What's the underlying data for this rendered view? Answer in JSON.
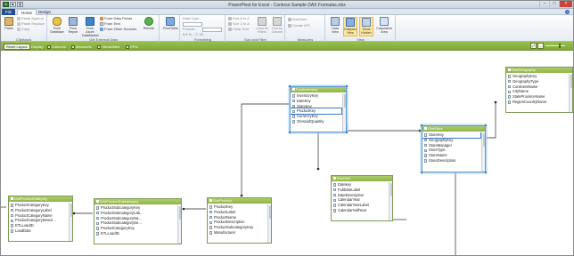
{
  "window": {
    "title": "PowerPivot for Excel - Contoso Sample DAX Formulas.xlsx"
  },
  "tabs": {
    "file": "File",
    "home": "Home",
    "design": "Design"
  },
  "ribbon": {
    "clipboard": {
      "label": "Clipboard",
      "paste": "Paste",
      "paste_append": "Paste Append",
      "paste_replace": "Paste Replace",
      "copy": "Copy"
    },
    "external": {
      "label": "Get External Data",
      "from_database": "From Database",
      "from_report": "From Report",
      "from_azure": "From Azure DataMarket",
      "from_data_feeds": "From Data Feeds",
      "from_text": "From Text",
      "from_other": "From Other Sources",
      "refresh": "Refresh"
    },
    "pivot": {
      "pivottable": "PivotTable"
    },
    "formatting": {
      "label": "Formatting",
      "data_type": "Data Type :",
      "format": "Format :"
    },
    "sort": {
      "label": "Sort and Filter",
      "asc": "Sort A to Z",
      "desc": "Sort Z to A",
      "clear_sort": "Clear Sort",
      "clear_filters": "Clear All Filters",
      "sort_by_column": "Sort by Column"
    },
    "measures": {
      "label": "Measures",
      "autosum": "AutoSum",
      "create_kpi": "Create KPI"
    },
    "view": {
      "label": "View",
      "data_view": "Data View",
      "diagram_view": "Diagram View",
      "show_hidden": "Show Hidden",
      "calc_area": "Calculation Area"
    }
  },
  "actionbar": {
    "reset_layout": "Reset Layout",
    "display": "Display:",
    "columns": "Columns",
    "measures": "Measures",
    "hierarchies": "Hierarchies",
    "kpis": "KPIs"
  },
  "tables": [
    {
      "name": "FactInventory",
      "selected": true,
      "highlight": 3,
      "fields": [
        "InventoryKey",
        "DateKey",
        "StoreKey",
        "ProductKey",
        "CurrencyKey",
        "OnHandQuantity"
      ]
    },
    {
      "name": "DimGeography",
      "selected": false,
      "highlight": -1,
      "fields": [
        "GeographyKey",
        "GeographyType",
        "ContinentName",
        "CityName",
        "StateProvinceName",
        "RegionCountryName"
      ]
    },
    {
      "name": "DimStore",
      "selected": true,
      "highlight": 0,
      "fields": [
        "StoreKey",
        "GeographyKey",
        "StoreManager",
        "StoreType",
        "StoreName",
        "StoreDescription"
      ]
    },
    {
      "name": "DimDate",
      "selected": false,
      "highlight": -1,
      "fields": [
        "Datekey",
        "FullDateLabel",
        "DateDescription",
        "CalendarYear",
        "CalendarYearLabel",
        "CalendarHalfYear"
      ]
    },
    {
      "name": "DimProductCategory",
      "selected": false,
      "highlight": -1,
      "fields": [
        "ProductCategoryKey",
        "ProductCategoryLabel",
        "ProductCategoryName",
        "ProductCategoryDescri...",
        "ETLLoadID",
        "LoadDate"
      ]
    },
    {
      "name": "DimProductSubcategory",
      "selected": false,
      "highlight": -1,
      "fields": [
        "ProductSubcategoryKey",
        "ProductSubcategoryLab...",
        "ProductSubcategoryNa...",
        "ProductSubcategoryDe...",
        "ProductCategoryKey",
        "ETLLoadID"
      ]
    },
    {
      "name": "DimProduct",
      "selected": false,
      "highlight": -1,
      "fields": [
        "ProductKey",
        "ProductLabel",
        "ProductName",
        "ProductDescription",
        "ProductSubcategoryKey",
        "Manufacturer"
      ]
    }
  ]
}
